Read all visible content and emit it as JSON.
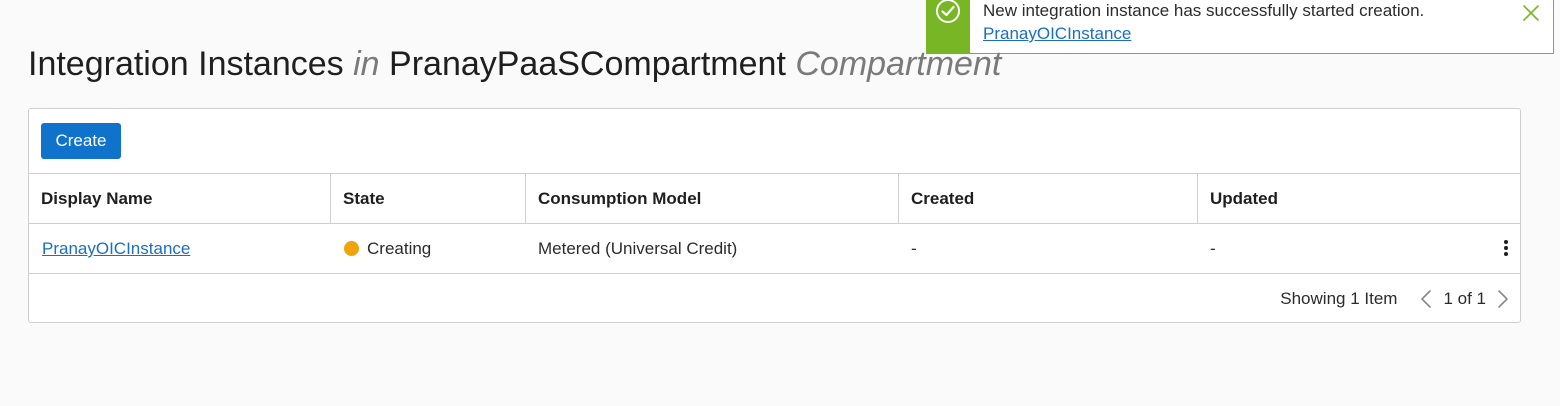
{
  "page": {
    "title_main": "Integration Instances",
    "title_in": "in",
    "compartment_name": "PranayPaaSCompartment",
    "compartment_suffix": "Compartment"
  },
  "toolbar": {
    "create_label": "Create"
  },
  "table": {
    "columns": [
      "Display Name",
      "State",
      "Consumption Model",
      "Created",
      "Updated"
    ],
    "rows": [
      {
        "display_name": "PranayOICInstance",
        "state": "Creating",
        "state_color": "#f0a30a",
        "consumption_model": "Metered (Universal Credit)",
        "created": "-",
        "updated": "-",
        "actions_icon": "kebab-menu-icon"
      }
    ]
  },
  "pagination": {
    "showing": "Showing 1 Item",
    "page": "1 of 1",
    "prev_icon": "chevron-left-icon",
    "next_icon": "chevron-right-icon"
  },
  "toast": {
    "message": "New integration instance has successfully started creation.",
    "link": "PranayOICInstance",
    "status_icon": "check-circle-icon",
    "close_icon": "close-icon",
    "accent_color": "#78b626"
  },
  "colors": {
    "primary": "#0f72cb",
    "link": "#1a6ec4",
    "success": "#78b626",
    "warning": "#f0a30a"
  }
}
